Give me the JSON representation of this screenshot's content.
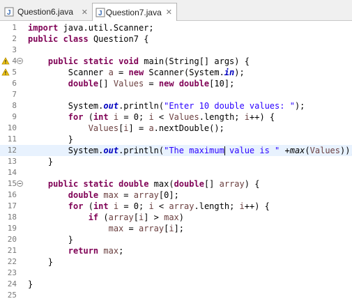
{
  "tabs": [
    {
      "label": "Question6.java",
      "active": false
    },
    {
      "label": "Question7.java",
      "active": true
    }
  ],
  "tab_close_glyph": "✕",
  "code_lines": [
    {
      "num": "1",
      "segments": [
        [
          "kw",
          "import"
        ],
        [
          "t",
          " java.util.Scanner;"
        ]
      ]
    },
    {
      "num": "2",
      "segments": [
        [
          "kw",
          "public"
        ],
        [
          "t",
          " "
        ],
        [
          "kw",
          "class"
        ],
        [
          "t",
          " Question7 {"
        ]
      ]
    },
    {
      "num": "3",
      "segments": []
    },
    {
      "num": "4",
      "fold": true,
      "marker": "warning",
      "segments": [
        [
          "t",
          "    "
        ],
        [
          "kw",
          "public"
        ],
        [
          "t",
          " "
        ],
        [
          "kw",
          "static"
        ],
        [
          "t",
          " "
        ],
        [
          "kw",
          "void"
        ],
        [
          "t",
          " main(String[] args) {"
        ]
      ]
    },
    {
      "num": "5",
      "marker": "warning",
      "segments": [
        [
          "t",
          "        Scanner "
        ],
        [
          "var",
          "a"
        ],
        [
          "t",
          " = "
        ],
        [
          "kw",
          "new"
        ],
        [
          "t",
          " Scanner(System."
        ],
        [
          "fld",
          "in"
        ],
        [
          "t",
          ");"
        ]
      ]
    },
    {
      "num": "6",
      "segments": [
        [
          "t",
          "        "
        ],
        [
          "kw",
          "double"
        ],
        [
          "t",
          "[] "
        ],
        [
          "var",
          "Values"
        ],
        [
          "t",
          " = "
        ],
        [
          "kw",
          "new"
        ],
        [
          "t",
          " "
        ],
        [
          "kw",
          "double"
        ],
        [
          "t",
          "[10];"
        ]
      ]
    },
    {
      "num": "7",
      "segments": []
    },
    {
      "num": "8",
      "segments": [
        [
          "t",
          "        System."
        ],
        [
          "fld",
          "out"
        ],
        [
          "t",
          ".println("
        ],
        [
          "str",
          "\"Enter 10 double values: \""
        ],
        [
          "t",
          ");"
        ]
      ]
    },
    {
      "num": "9",
      "segments": [
        [
          "t",
          "        "
        ],
        [
          "kw",
          "for"
        ],
        [
          "t",
          " ("
        ],
        [
          "kw",
          "int"
        ],
        [
          "t",
          " "
        ],
        [
          "var",
          "i"
        ],
        [
          "t",
          " = 0; "
        ],
        [
          "var",
          "i"
        ],
        [
          "t",
          " < "
        ],
        [
          "var",
          "Values"
        ],
        [
          "t",
          ".length; "
        ],
        [
          "var",
          "i"
        ],
        [
          "t",
          "++) {"
        ]
      ]
    },
    {
      "num": "10",
      "segments": [
        [
          "t",
          "            "
        ],
        [
          "var",
          "Values"
        ],
        [
          "t",
          "["
        ],
        [
          "var",
          "i"
        ],
        [
          "t",
          "] = "
        ],
        [
          "var",
          "a"
        ],
        [
          "t",
          ".nextDouble();"
        ]
      ]
    },
    {
      "num": "11",
      "segments": [
        [
          "t",
          "        }"
        ]
      ]
    },
    {
      "num": "12",
      "highlight": true,
      "segments": [
        [
          "t",
          "        System."
        ],
        [
          "fld",
          "out"
        ],
        [
          "t",
          ".println("
        ],
        [
          "str",
          "\"The maximum"
        ],
        [
          "caret",
          ""
        ],
        [
          "str",
          " value is \""
        ],
        [
          "t",
          " +"
        ],
        [
          "it",
          "max"
        ],
        [
          "t",
          "("
        ],
        [
          "var",
          "Values"
        ],
        [
          "t",
          "));"
        ]
      ]
    },
    {
      "num": "13",
      "segments": [
        [
          "t",
          "    }"
        ]
      ]
    },
    {
      "num": "14",
      "segments": []
    },
    {
      "num": "15",
      "fold": true,
      "segments": [
        [
          "t",
          "    "
        ],
        [
          "kw",
          "public"
        ],
        [
          "t",
          " "
        ],
        [
          "kw",
          "static"
        ],
        [
          "t",
          " "
        ],
        [
          "kw",
          "double"
        ],
        [
          "t",
          " max("
        ],
        [
          "kw",
          "double"
        ],
        [
          "t",
          "[] "
        ],
        [
          "var",
          "array"
        ],
        [
          "t",
          ") {"
        ]
      ]
    },
    {
      "num": "16",
      "segments": [
        [
          "t",
          "        "
        ],
        [
          "kw",
          "double"
        ],
        [
          "t",
          " "
        ],
        [
          "var",
          "max"
        ],
        [
          "t",
          " = "
        ],
        [
          "var",
          "array"
        ],
        [
          "t",
          "[0];"
        ]
      ]
    },
    {
      "num": "17",
      "segments": [
        [
          "t",
          "        "
        ],
        [
          "kw",
          "for"
        ],
        [
          "t",
          " ("
        ],
        [
          "kw",
          "int"
        ],
        [
          "t",
          " "
        ],
        [
          "var",
          "i"
        ],
        [
          "t",
          " = 0; "
        ],
        [
          "var",
          "i"
        ],
        [
          "t",
          " < "
        ],
        [
          "var",
          "array"
        ],
        [
          "t",
          ".length; "
        ],
        [
          "var",
          "i"
        ],
        [
          "t",
          "++) {"
        ]
      ]
    },
    {
      "num": "18",
      "segments": [
        [
          "t",
          "            "
        ],
        [
          "kw",
          "if"
        ],
        [
          "t",
          " ("
        ],
        [
          "var",
          "array"
        ],
        [
          "t",
          "["
        ],
        [
          "var",
          "i"
        ],
        [
          "t",
          "] > "
        ],
        [
          "var",
          "max"
        ],
        [
          "t",
          ")"
        ]
      ]
    },
    {
      "num": "19",
      "segments": [
        [
          "t",
          "                "
        ],
        [
          "var",
          "max"
        ],
        [
          "t",
          " = "
        ],
        [
          "var",
          "array"
        ],
        [
          "t",
          "["
        ],
        [
          "var",
          "i"
        ],
        [
          "t",
          "];"
        ]
      ]
    },
    {
      "num": "20",
      "segments": [
        [
          "t",
          "        }"
        ]
      ]
    },
    {
      "num": "21",
      "segments": [
        [
          "t",
          "        "
        ],
        [
          "kw",
          "return"
        ],
        [
          "t",
          " "
        ],
        [
          "var",
          "max"
        ],
        [
          "t",
          ";"
        ]
      ]
    },
    {
      "num": "22",
      "segments": [
        [
          "t",
          "    }"
        ]
      ]
    },
    {
      "num": "23",
      "segments": []
    },
    {
      "num": "24",
      "segments": [
        [
          "t",
          "}"
        ]
      ]
    },
    {
      "num": "25",
      "segments": []
    }
  ]
}
